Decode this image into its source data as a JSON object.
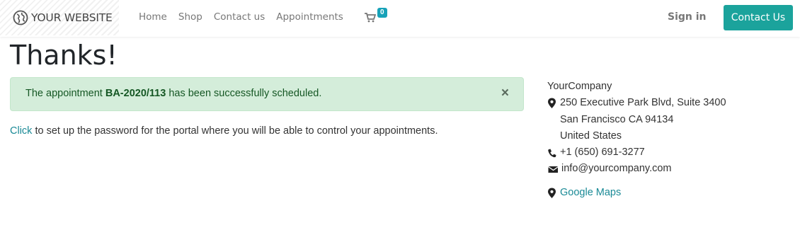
{
  "header": {
    "brand": "YOUR WEBSITE",
    "nav": [
      "Home",
      "Shop",
      "Contact us",
      "Appointments"
    ],
    "cart_count": "0",
    "signin": "Sign in",
    "contact_button": "Contact Us"
  },
  "main": {
    "title": "Thanks!",
    "alert": {
      "prefix": "The appointment ",
      "code": "BA-2020/113",
      "suffix": " has been successfully scheduled.",
      "close": "×"
    },
    "portal": {
      "link": "Click",
      "text": " to set up the password for the portal where you will be able to control your appointments."
    }
  },
  "company": {
    "name": "YourCompany",
    "street": "250 Executive Park Blvd, Suite 3400",
    "city": "San Francisco CA 94134",
    "country": "United States",
    "phone": "+1 (650) 691-3277",
    "email": "info@yourcompany.com",
    "maps": "Google Maps"
  },
  "colors": {
    "accent": "#1ba39c",
    "alert_bg": "#d4edda",
    "alert_text": "#155724",
    "link": "#1a8a96",
    "badge": "#17a2b8"
  },
  "icons": [
    "globe-icon",
    "cart-icon",
    "close-icon",
    "map-marker-icon",
    "phone-icon",
    "envelope-icon"
  ]
}
